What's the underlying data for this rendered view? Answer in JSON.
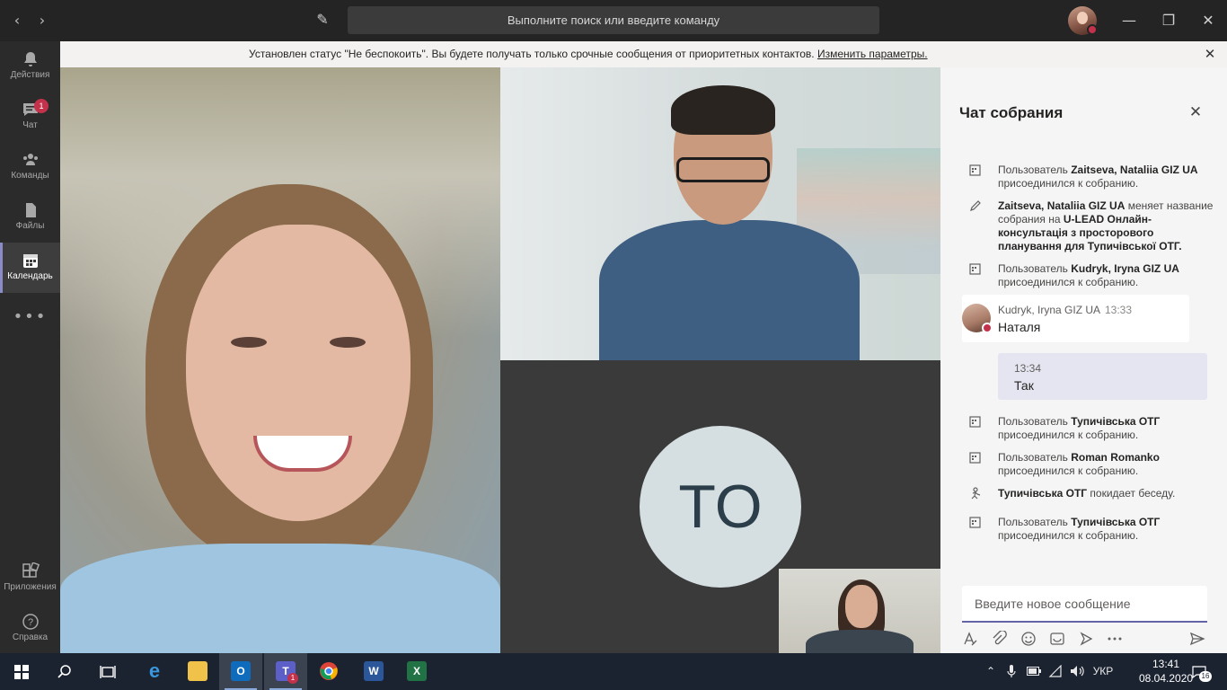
{
  "titlebar": {
    "search_placeholder": "Выполните поиск или введите команду",
    "back_icon": "‹",
    "forward_icon": "›",
    "compose_icon": "✎",
    "minimize_icon": "—",
    "maximize_icon": "❐",
    "close_icon": "✕"
  },
  "rail": {
    "items": [
      {
        "label": "Действия",
        "icon": "bell-icon"
      },
      {
        "label": "Чат",
        "icon": "chat-icon",
        "badge": "1"
      },
      {
        "label": "Команды",
        "icon": "teams-icon"
      },
      {
        "label": "Файлы",
        "icon": "files-icon"
      },
      {
        "label": "Календарь",
        "icon": "calendar-icon",
        "active": true
      }
    ],
    "more": "•••",
    "bottom": [
      {
        "label": "Приложения",
        "icon": "apps-icon"
      },
      {
        "label": "Справка",
        "icon": "help-icon"
      }
    ]
  },
  "banner": {
    "text": "Установлен статус \"Не беспокоить\". Вы будете получать только срочные сообщения от приоритетных контактов. ",
    "link": "Изменить параметры.",
    "close_icon": "✕"
  },
  "stage": {
    "placeholder_initials": "TO"
  },
  "chat": {
    "title": "Чат собрания",
    "close_icon": "✕",
    "events": [
      {
        "icon": "calendar-join-icon",
        "pre": "Пользователь ",
        "name": "Zaitseva, Nataliia GIZ UA",
        "post": " присоединился к собранию."
      },
      {
        "icon": "pencil-icon",
        "pre": "",
        "name": "Zaitseva, Nataliia GIZ UA",
        "post": " меняет название собрания на ",
        "name2": "U-LEAD Онлайн-консультація з просторового планування для Тупичівської ОТГ."
      },
      {
        "icon": "calendar-join-icon",
        "pre": "Пользователь ",
        "name": "Kudryk, Iryna GIZ UA",
        "post": " присоединился к собранию."
      },
      {
        "icon": "calendar-join-icon",
        "pre": "Пользователь ",
        "name": "Тупичівська ОТГ",
        "post": " присоединился к собранию."
      },
      {
        "icon": "calendar-join-icon",
        "pre": "Пользователь ",
        "name": "Roman Romanko",
        "post": " присоединился к собранию."
      },
      {
        "icon": "leave-icon",
        "pre": "",
        "name": "Тупичівська ОТГ",
        "post": " покидает беседу."
      },
      {
        "icon": "calendar-join-icon",
        "pre": "Пользователь ",
        "name": "Тупичівська ОТГ",
        "post": " присоединился к собранию."
      }
    ],
    "message_in": {
      "author": "Kudryk, Iryna GIZ UA",
      "time": "13:33",
      "text": "Наталя"
    },
    "message_out": {
      "time": "13:34",
      "text": "Так"
    },
    "compose_placeholder": "Введите новое сообщение",
    "tools": [
      "format-icon",
      "attach-icon",
      "emoji-icon",
      "sticker-icon",
      "meet-icon",
      "more-icon",
      "send-icon"
    ]
  },
  "taskbar": {
    "language": "УКР",
    "time": "13:41",
    "date": "08.04.2020",
    "notifications": "16",
    "teams_badge": "1",
    "apps": [
      "start-icon",
      "search-icon",
      "task-view-icon",
      "edge-icon",
      "explorer-icon",
      "outlook-icon",
      "teams-icon",
      "chrome-icon",
      "word-icon",
      "excel-icon"
    ]
  },
  "colors": {
    "accent": "#6264a7",
    "dnd": "#c4314b",
    "rail_bg": "#2b2b2b",
    "titlebar_bg": "#242424",
    "taskbar_bg": "#1b2230"
  }
}
